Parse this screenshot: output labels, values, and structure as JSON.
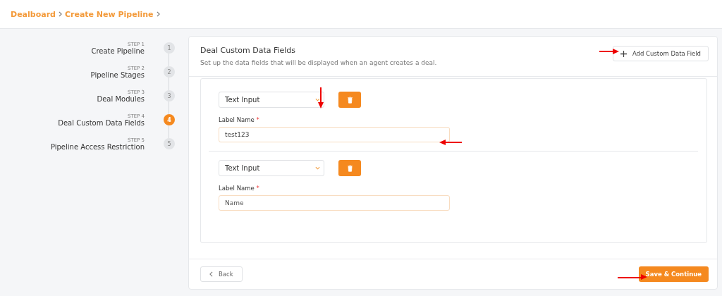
{
  "breadcrumb": [
    {
      "label": "Dealboard"
    },
    {
      "label": "Create New Pipeline"
    }
  ],
  "steps": [
    {
      "step": "STEP 1",
      "title": "Create Pipeline",
      "number": "1",
      "selected": false
    },
    {
      "step": "STEP 2",
      "title": "Pipeline Stages",
      "number": "2",
      "selected": false
    },
    {
      "step": "STEP 3",
      "title": "Deal Modules",
      "number": "3",
      "selected": false
    },
    {
      "step": "STEP 4",
      "title": "Deal Custom Data Fields",
      "number": "4",
      "selected": true
    },
    {
      "step": "STEP 5",
      "title": "Pipeline Access Restriction",
      "number": "5",
      "selected": false
    }
  ],
  "card": {
    "title": "Deal Custom Data Fields",
    "subtitle": "Set up the data fields that will be displayed when an agent creates a deal.",
    "add_button": "Add Custom Data Field"
  },
  "fields": [
    {
      "type": "Text Input",
      "label": "Label Name",
      "required_mark": "*",
      "value": "test123"
    },
    {
      "type": "Text Input",
      "label": "Label Name",
      "required_mark": "*",
      "placeholder": "Name"
    }
  ],
  "footer": {
    "back": "Back",
    "save": "Save & Continue"
  }
}
